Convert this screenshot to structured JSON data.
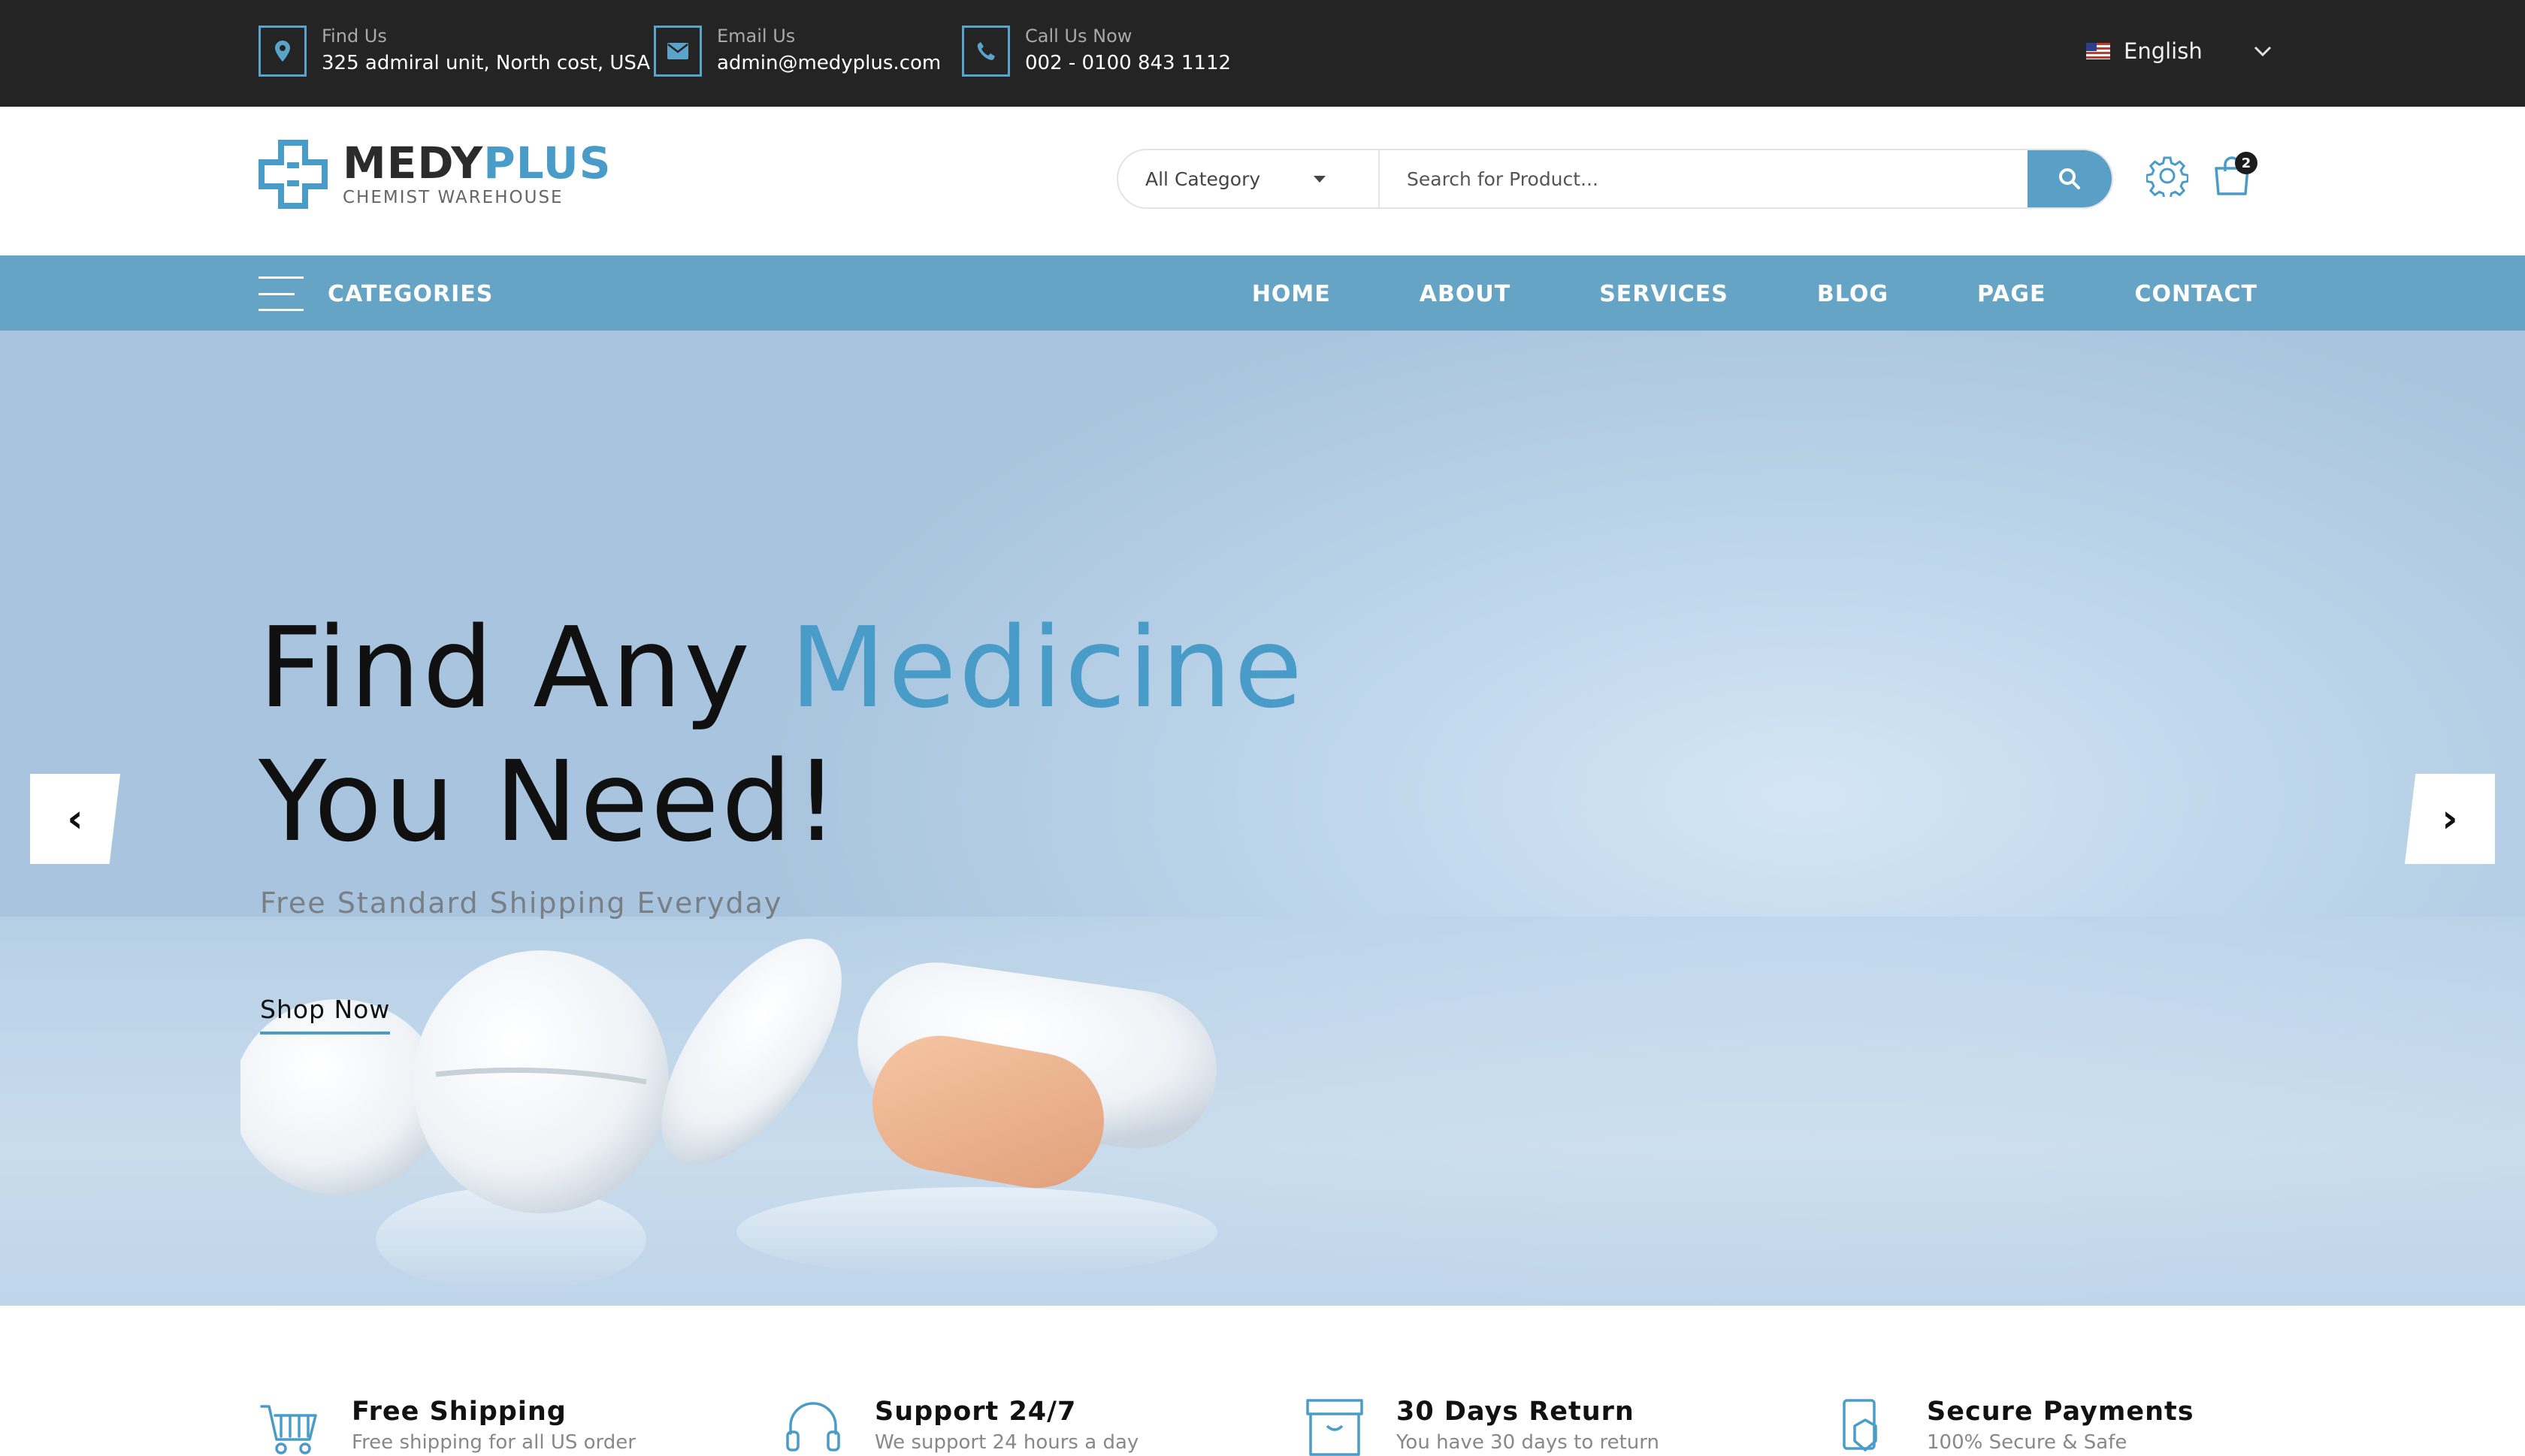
{
  "topbar": {
    "contacts": [
      {
        "label": "Find Us",
        "value": "325 admiral unit, North cost, USA",
        "icon": "map-pin-icon"
      },
      {
        "label": "Email Us",
        "value": "admin@medyplus.com",
        "icon": "envelope-icon"
      },
      {
        "label": "Call Us Now",
        "value": "002 - 0100 843 1112",
        "icon": "phone-icon"
      }
    ],
    "language": "English"
  },
  "header": {
    "logo_main_1": "MEDY",
    "logo_main_2": "PLUS",
    "logo_sub": "CHEMIST WAREHOUSE",
    "category_select": "All Category",
    "search_placeholder": "Search for Product...",
    "cart_count": "2"
  },
  "nav": {
    "categories_label": "CATEGORIES",
    "items": [
      "HOME",
      "ABOUT",
      "SERVICES",
      "BLOG",
      "PAGE",
      "CONTACT"
    ]
  },
  "hero": {
    "title_part1": "Find Any ",
    "title_highlight": "Medicine",
    "title_line2": "You Need!",
    "subtitle": "Free Standard Shipping Everyday",
    "cta": "Shop Now",
    "prev": "‹",
    "next": "›"
  },
  "features": [
    {
      "title": "Free Shipping",
      "desc": "Free shipping for all US order",
      "icon": "cart-icon"
    },
    {
      "title": "Support 24/7",
      "desc": "We support 24 hours a day",
      "icon": "headset-icon"
    },
    {
      "title": "30 Days Return",
      "desc": "You have 30 days to return",
      "icon": "return-box-icon"
    },
    {
      "title": "Secure Payments",
      "desc": "100% Secure & Safe",
      "icon": "secure-card-icon"
    }
  ],
  "colors": {
    "accent": "#4a9cc8",
    "nav_bg": "#66a4c6",
    "topbar_bg": "#242424"
  }
}
